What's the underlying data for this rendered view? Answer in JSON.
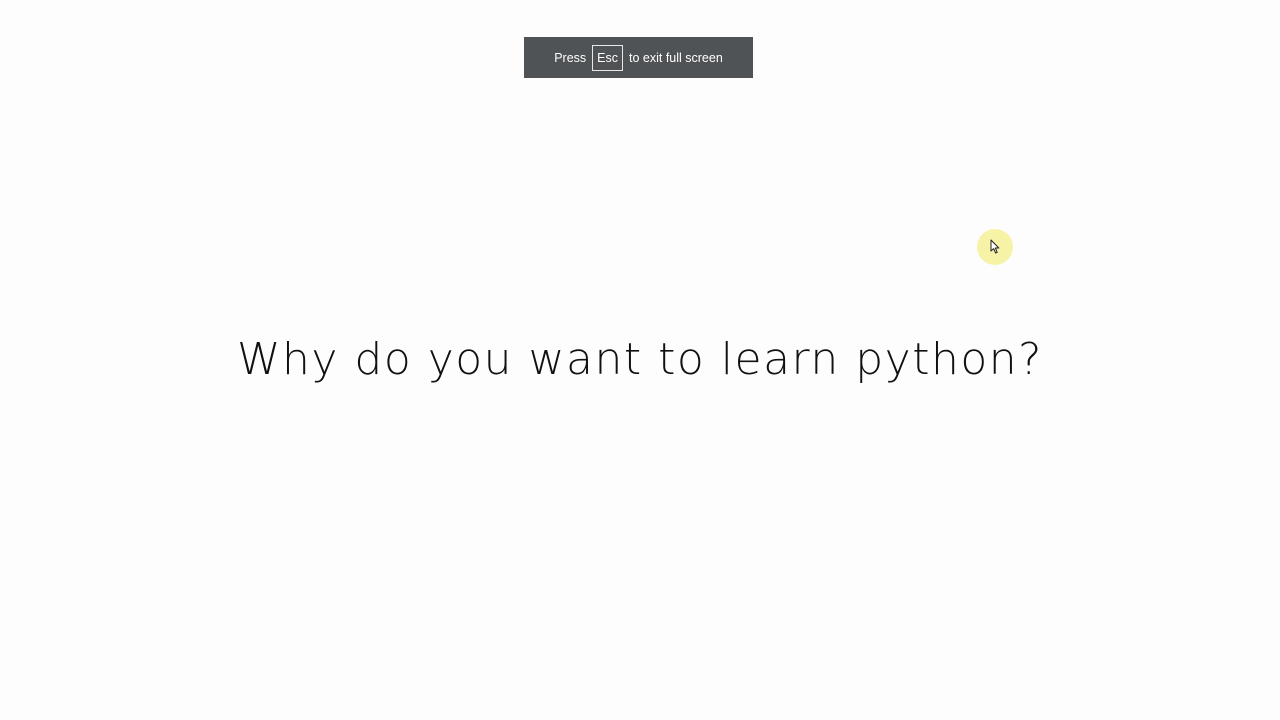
{
  "fullscreen_notice": {
    "prefix": "Press",
    "key": "Esc",
    "suffix": "to exit full screen"
  },
  "slide": {
    "headline": "Why do you want to learn python?"
  },
  "cursor": {
    "icon": "mouse-pointer-icon",
    "highlight_color": "#f5f096"
  },
  "colors": {
    "background": "#fdfdfd",
    "notice_background": "#4f5355",
    "text": "#111111"
  }
}
